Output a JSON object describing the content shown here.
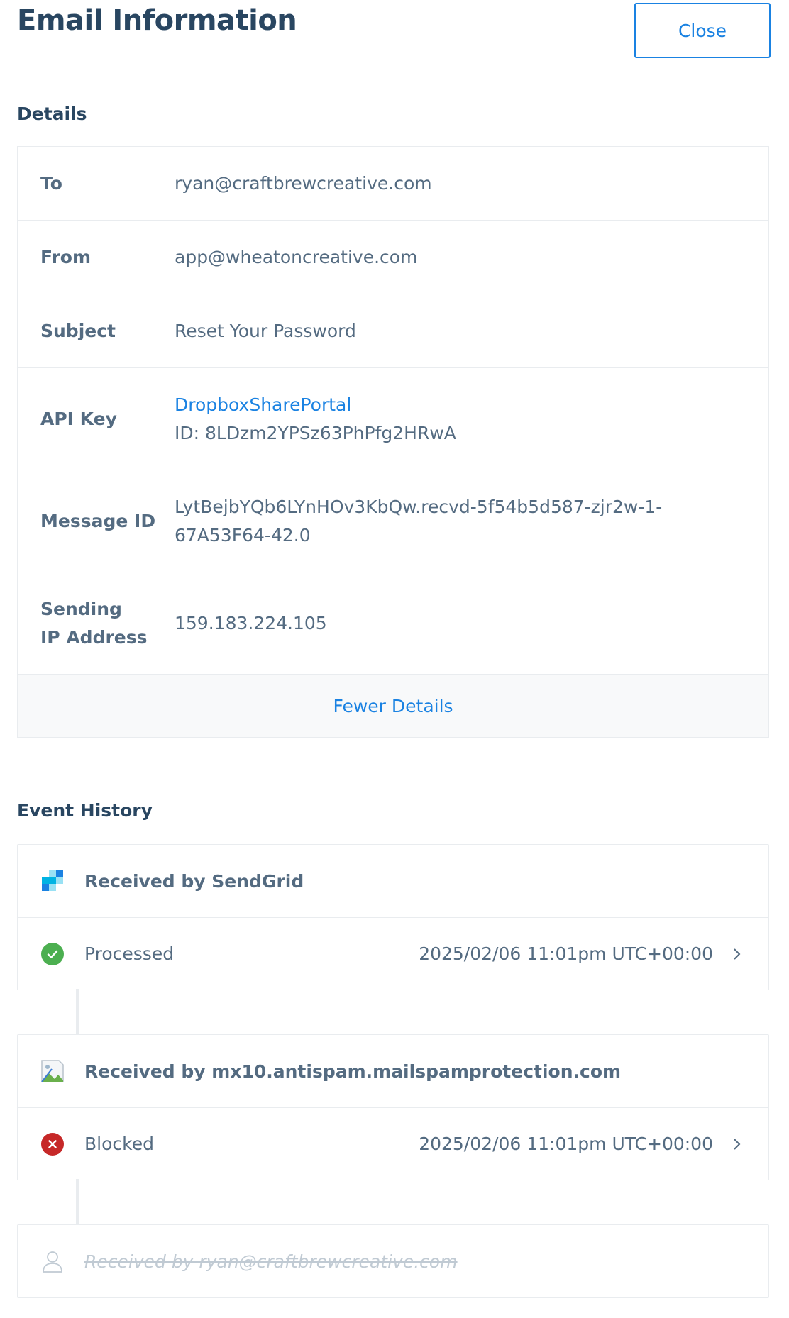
{
  "header": {
    "title": "Email Information",
    "close_label": "Close"
  },
  "details": {
    "section_title": "Details",
    "rows": [
      {
        "label": "To",
        "value": "ryan@craftbrewcreative.com"
      },
      {
        "label": "From",
        "value": "app@wheatoncreative.com"
      },
      {
        "label": "Subject",
        "value": "Reset Your Password"
      },
      {
        "label": "API Key",
        "link": "DropboxSharePortal",
        "value": "ID: 8LDzm2YPSz63PhPfg2HRwA"
      },
      {
        "label": "Message ID",
        "value_line1": "LytBejbYQb6LYnHOv3KbQw.recvd-5f54b5d587-zjr2w-1-",
        "value_line2": "67A53F64-42.0"
      },
      {
        "label_line1": "Sending",
        "label_line2": "IP Address",
        "value": "159.183.224.105"
      }
    ],
    "toggle_label": "Fewer Details"
  },
  "events": {
    "section_title": "Event History",
    "groups": [
      {
        "header": "Received by SendGrid",
        "icon": "sendgrid-logo-icon",
        "status": "Processed",
        "status_icon": "check-circle-icon",
        "timestamp": "2025/02/06 11:01pm UTC+00:00"
      },
      {
        "header": "Received by mx10.antispam.mailspamprotection.com",
        "icon": "broken-image-icon",
        "status": "Blocked",
        "status_icon": "x-circle-icon",
        "timestamp": "2025/02/06 11:01pm UTC+00:00"
      },
      {
        "header": "Received by ryan@craftbrewcreative.com",
        "icon": "user-icon"
      }
    ]
  },
  "colors": {
    "brand_blue": "#1a82e2",
    "heading": "#294661",
    "text": "#546b81",
    "success": "#4caf50",
    "danger": "#c62828",
    "border": "#e9ecef"
  }
}
